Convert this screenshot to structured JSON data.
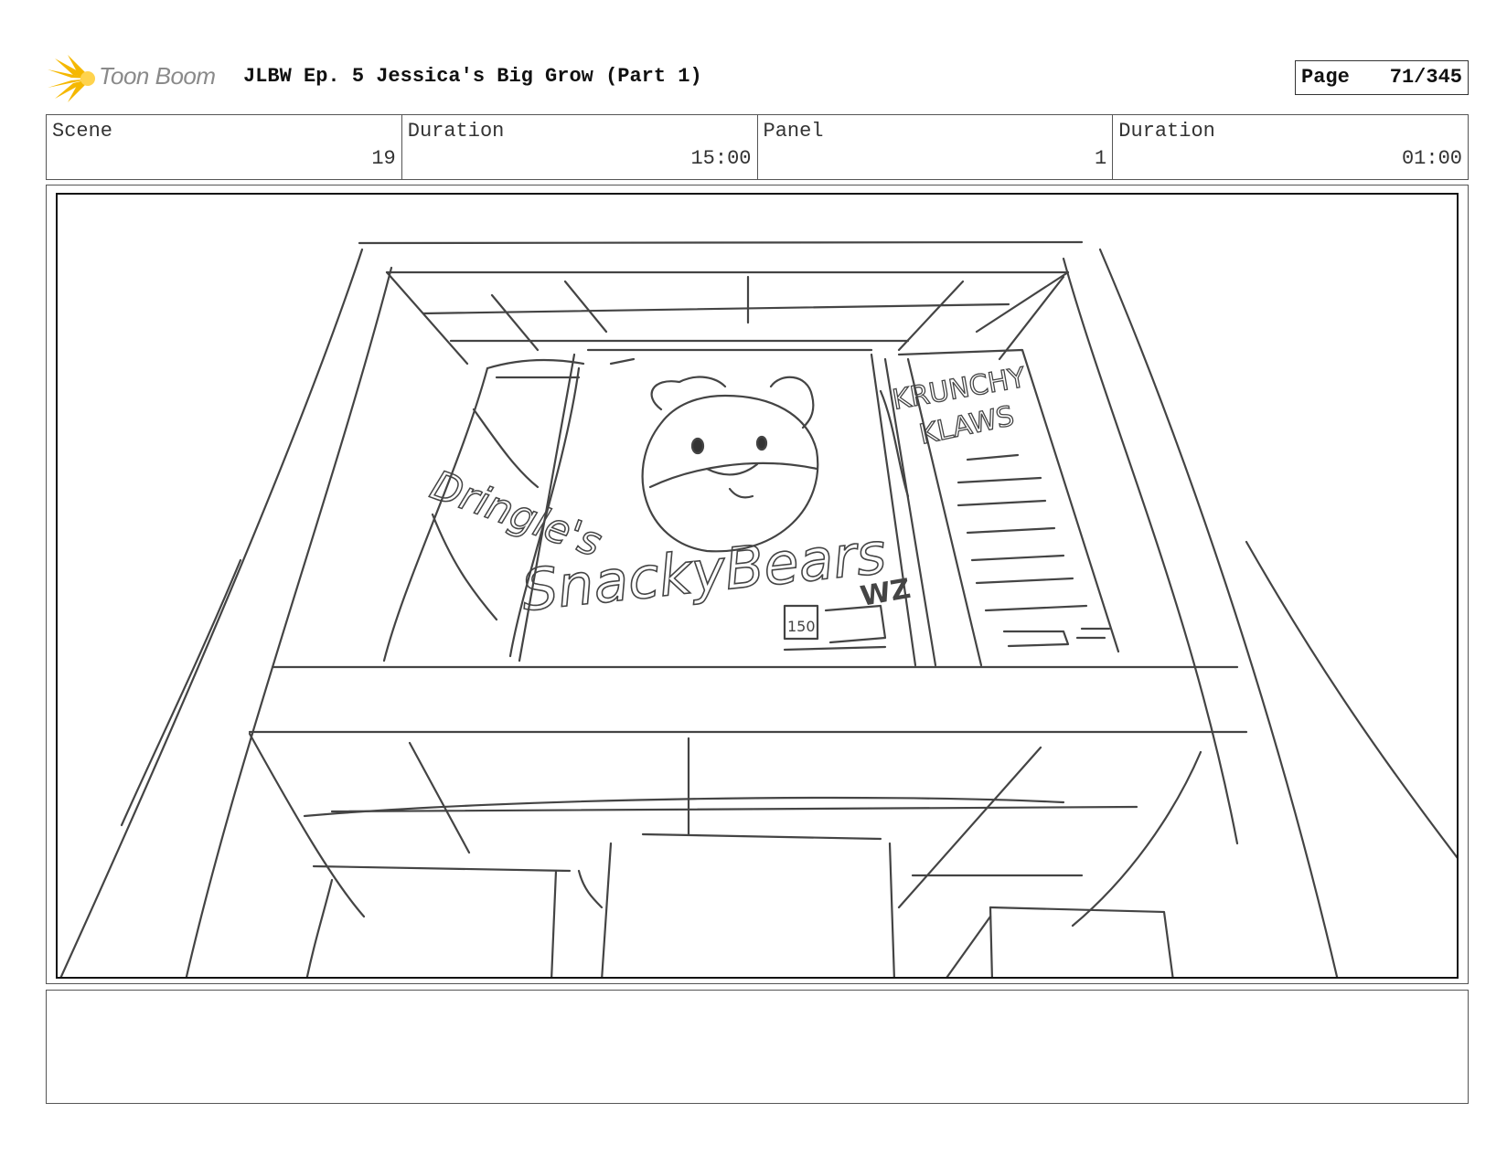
{
  "header": {
    "logo_text": "Toon Boom",
    "title": "JLBW Ep. 5 Jessica's Big Grow (Part 1)",
    "page_label": "Page",
    "page_value": "71/345"
  },
  "info": {
    "scene_label": "Scene",
    "scene_value": "19",
    "scene_duration_label": "Duration",
    "scene_duration_value": "15:00",
    "panel_label": "Panel",
    "panel_value": "1",
    "panel_duration_label": "Duration",
    "panel_duration_value": "01:00"
  },
  "sketch": {
    "box_left_text": "Dringle's",
    "box_center_text": "SnackyBears",
    "box_center_badge": "150",
    "box_right_text_1": "KRUNCHY",
    "box_right_text_2": "KLAWS",
    "box_partial_text": "WZ"
  },
  "notes": {}
}
